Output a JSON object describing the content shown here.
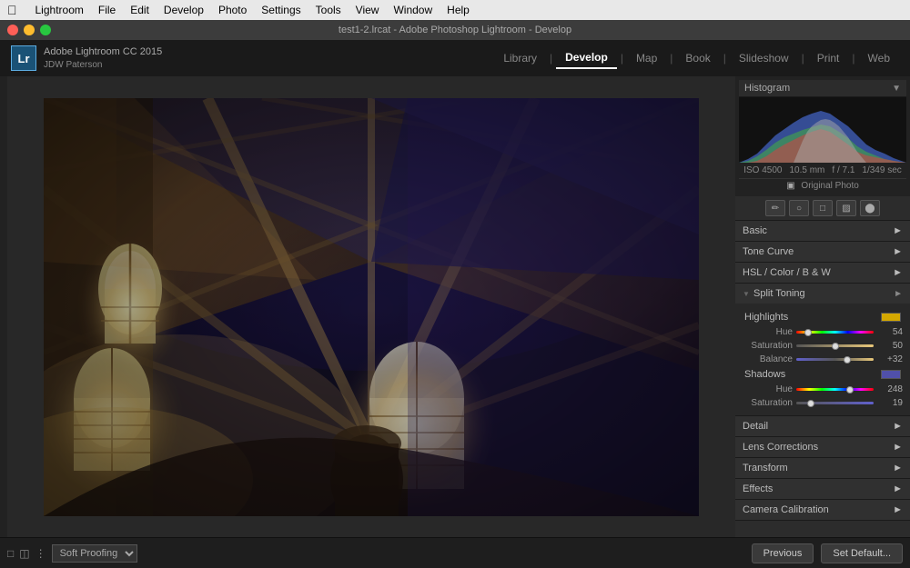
{
  "menubar": {
    "apple": "⌘",
    "items": [
      "Lightroom",
      "File",
      "Edit",
      "Develop",
      "Photo",
      "Settings",
      "Tools",
      "View",
      "Window",
      "Help"
    ]
  },
  "titlebar": {
    "title": "test1-2.lrcat - Adobe Photoshop Lightroom - Develop"
  },
  "logo": {
    "badge": "Lr",
    "software": "Adobe Lightroom CC 2015",
    "user": "JDW Paterson"
  },
  "nav": {
    "tabs": [
      "Library",
      "Develop",
      "Map",
      "Book",
      "Slideshow",
      "Print",
      "Web"
    ],
    "active": "Develop",
    "separator": "|"
  },
  "histogram": {
    "label": "Histogram",
    "info": {
      "iso": "ISO 4500",
      "focal": "10.5 mm",
      "aperture": "f / 7.1",
      "shutter": "1/349 sec"
    },
    "original_photo": "Original Photo"
  },
  "tools": {
    "items": [
      "⊞",
      "○",
      "□",
      "□",
      "◎"
    ]
  },
  "panels": {
    "basic": {
      "label": "Basic",
      "active": true
    },
    "tone_curve": {
      "label": "Tone Curve",
      "active": false
    },
    "hsl": {
      "label": "HSL / Color / B & W",
      "active": false
    },
    "split_toning": {
      "label": "Split Toning",
      "active": true,
      "highlights": {
        "label": "Highlights",
        "swatch_color": "#d4a800",
        "hue": {
          "label": "Hue",
          "value": 54,
          "percent": 15
        },
        "saturation": {
          "label": "Saturation",
          "value": 50,
          "percent": 50
        }
      },
      "balance": {
        "label": "Balance",
        "value": "+32",
        "percent": 66
      },
      "shadows": {
        "label": "Shadows",
        "swatch_color": "#5050aa",
        "hue": {
          "label": "Hue",
          "value": 248,
          "percent": 69
        },
        "saturation": {
          "label": "Saturation",
          "value": 19,
          "percent": 19
        }
      }
    },
    "detail": {
      "label": "Detail"
    },
    "lens_corrections": {
      "label": "Lens Corrections"
    },
    "transform": {
      "label": "Transform"
    },
    "effects": {
      "label": "Effects"
    },
    "camera_calibration": {
      "label": "Camera Calibration"
    }
  },
  "bottom": {
    "soft_proofing": "Soft Proofing",
    "previous_btn": "Previous",
    "set_default_btn": "Set Default..."
  }
}
